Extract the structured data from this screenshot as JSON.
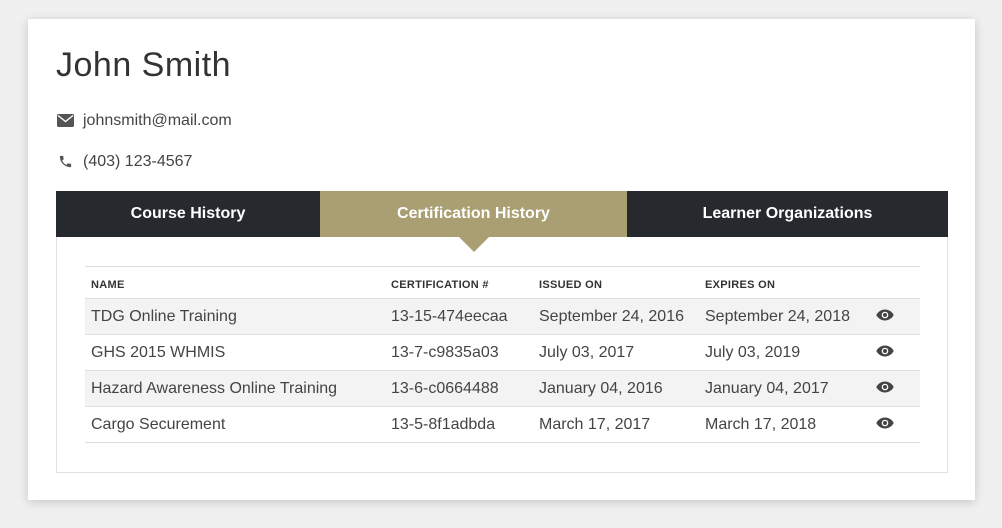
{
  "profile": {
    "name": "John Smith",
    "email": "johnsmith@mail.com",
    "phone": "(403) 123-4567",
    "email_icon": "envelope-icon",
    "phone_icon": "phone-icon"
  },
  "tabs": [
    {
      "label": "Course History",
      "active": false
    },
    {
      "label": "Certification History",
      "active": true
    },
    {
      "label": "Learner Organizations",
      "active": false
    }
  ],
  "colors": {
    "tab_bar": "#262a2e",
    "accent": "#a99f73"
  },
  "table": {
    "columns": [
      "NAME",
      "CERTIFICATION #",
      "ISSUED ON",
      "EXPIRES ON"
    ],
    "rows": [
      {
        "name": "TDG Online Training",
        "cert": "13-15-474eecaa",
        "issued": "September 24, 2016",
        "expires": "September 24, 2018",
        "action_icon": "eye-icon"
      },
      {
        "name": "GHS 2015 WHMIS",
        "cert": "13-7-c9835a03",
        "issued": "July 03, 2017",
        "expires": "July 03, 2019",
        "action_icon": "eye-icon"
      },
      {
        "name": "Hazard Awareness Online Training",
        "cert": "13-6-c0664488",
        "issued": "January 04, 2016",
        "expires": "January 04, 2017",
        "action_icon": "eye-icon"
      },
      {
        "name": "Cargo Securement",
        "cert": "13-5-8f1adbda",
        "issued": "March 17, 2017",
        "expires": "March 17, 2018",
        "action_icon": "eye-icon"
      }
    ]
  }
}
